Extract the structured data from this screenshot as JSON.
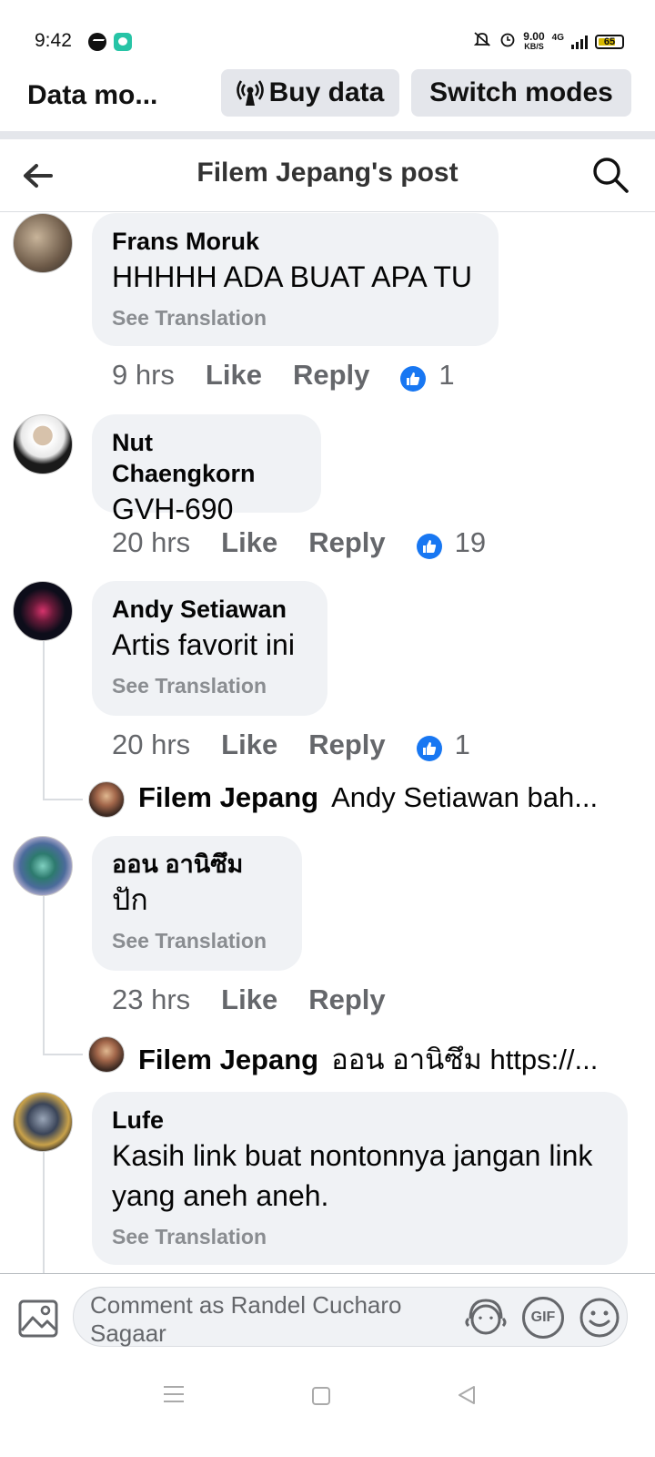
{
  "status_bar": {
    "time": "9:42",
    "speed_value": "9.00",
    "speed_unit": "KB/S",
    "network": "4G",
    "battery": "65"
  },
  "data_bar": {
    "title": "Data mo...",
    "buy_label": "Buy data",
    "switch_label": "Switch modes"
  },
  "header": {
    "title": "Filem Jepang's post"
  },
  "comments": [
    {
      "author": "Frans Moruk",
      "text": "HHHHH ADA BUAT APA TU",
      "translate": "See Translation",
      "time": "9 hrs",
      "like": "Like",
      "reply": "Reply",
      "reactions": "1"
    },
    {
      "author": "Nut Chaengkorn",
      "text": "GVH-690",
      "time": "20 hrs",
      "like": "Like",
      "reply": "Reply",
      "reactions": "19"
    },
    {
      "author": "Andy Setiawan",
      "text": "Artis favorit ini",
      "translate": "See Translation",
      "time": "20 hrs",
      "like": "Like",
      "reply": "Reply",
      "reactions": "1",
      "reply_preview": {
        "author": "Filem Jepang",
        "text": "Andy Setiawan bah..."
      }
    },
    {
      "author": "ออน อานิซึม",
      "text": "ปัก",
      "translate": "See Translation",
      "time": "23 hrs",
      "like": "Like",
      "reply": "Reply",
      "reply_preview": {
        "author": "Filem Jepang",
        "text": "ออน อานิซึม https://..."
      }
    },
    {
      "author": "Lufe",
      "text_line1": "Kasih link buat nontonnya jangan link",
      "text_line2": "yang aneh aneh.",
      "translate": "See Translation"
    }
  ],
  "composer": {
    "placeholder_line1": "Comment as Randel Cucharo",
    "placeholder_line2": "Sagaar",
    "gif_label": "GIF"
  },
  "colors": {
    "accent": "#1877f2",
    "bubble": "#f0f2f5",
    "muted": "#65676b"
  }
}
